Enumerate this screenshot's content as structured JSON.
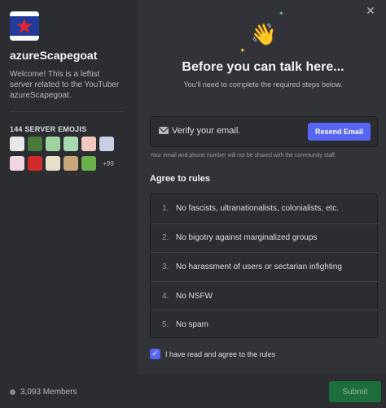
{
  "sidebar": {
    "server_name": "azureScapegoat",
    "description": "Welcome! This is a leftist server related to the YouTuber azureScapegoat.",
    "emoji_heading": "144 SERVER EMOJIS",
    "emojis": [
      {
        "name": "emoji-1",
        "color": "#e8e8e8"
      },
      {
        "name": "emoji-2",
        "color": "#4a7a3a"
      },
      {
        "name": "emoji-3",
        "color": "#9fd3a0"
      },
      {
        "name": "emoji-4",
        "color": "#a8d8b0"
      },
      {
        "name": "emoji-5",
        "color": "#f2c9c0"
      },
      {
        "name": "emoji-6",
        "color": "#c8d0e8"
      },
      {
        "name": "emoji-7",
        "color": "#f0d6e0"
      },
      {
        "name": "emoji-8",
        "color": "#d12a2a"
      },
      {
        "name": "emoji-9",
        "color": "#e8e0c8"
      },
      {
        "name": "emoji-10",
        "color": "#c8a878"
      },
      {
        "name": "emoji-11",
        "color": "#6ab04c"
      }
    ],
    "more_emojis": "+99",
    "member_count": "3,093 Members"
  },
  "main": {
    "title": "Before you can talk here...",
    "subtitle": "You'll need to complete the required steps below.",
    "verify": {
      "text": "Verify your email.",
      "button_label": "Resend Email"
    },
    "privacy_note": "Your email and phone number will not be shared with the community staff.",
    "rules_heading": "Agree to rules",
    "rules": [
      {
        "num": "1.",
        "text": "No fascists, ultranationalists, colonialists, etc."
      },
      {
        "num": "2.",
        "text": "No bigotry against marginalized groups"
      },
      {
        "num": "3.",
        "text": "No harassment of users or sectarian infighting"
      },
      {
        "num": "4.",
        "text": "No NSFW"
      },
      {
        "num": "5.",
        "text": "No spam"
      }
    ],
    "agree_label": "I have read and agree to the rules",
    "agree_checked": true,
    "submit_label": "Submit"
  },
  "colors": {
    "accent": "#5865f2",
    "submit": "#1d6e3d",
    "background": "#313338",
    "sidebar": "#2b2d31"
  },
  "icons": {
    "close": "close-icon",
    "wave": "waving-hand-icon",
    "mail": "mail-icon",
    "check": "check-icon"
  }
}
